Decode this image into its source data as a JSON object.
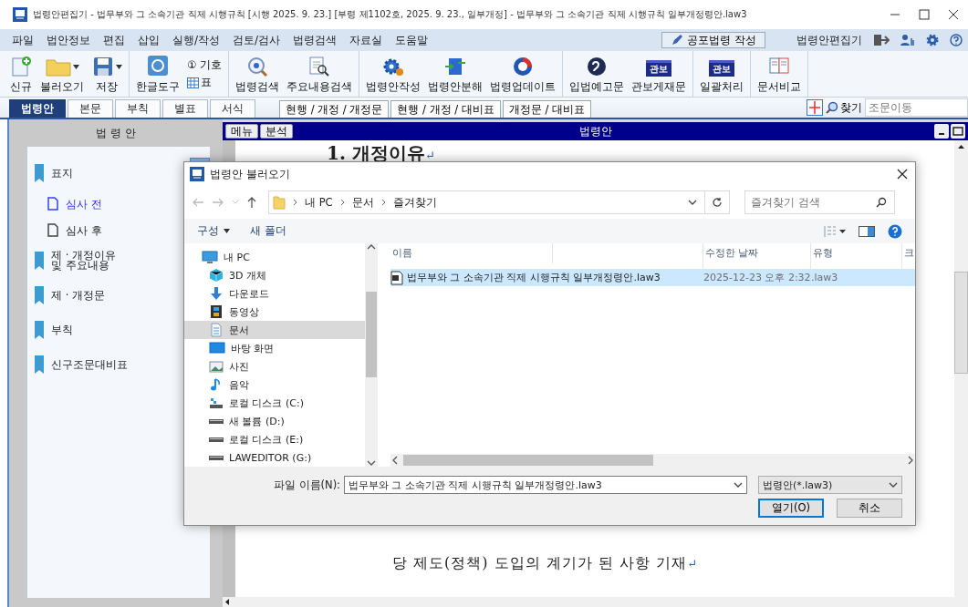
{
  "window": {
    "title": "법령안편집기 - 법무부와 그 소속기관 직제 시행규칙 [시행 2025. 9. 23.] [부령 제1102호, 2025. 9. 23., 일부개정] - 법무부와 그 소속기관 직제 시행규칙 일부개정령안.law3"
  },
  "menu": [
    "파일",
    "법안정보",
    "편집",
    "삽입",
    "실행/작성",
    "검토/검사",
    "법령검색",
    "자료실",
    "도움말"
  ],
  "menu_right": {
    "button": "공포법령 작성",
    "app_name": "법령안편집기"
  },
  "toolbar_groups": [
    {
      "items": [
        {
          "kind": "large",
          "label": "신규"
        },
        {
          "kind": "dropdown",
          "label": "불러오기"
        },
        {
          "kind": "dropdown",
          "label": "저장"
        }
      ]
    },
    {
      "items": [
        {
          "kind": "large",
          "label": "한글도구"
        },
        {
          "kind": "stack",
          "lines": [
            "① 기호",
            "표"
          ]
        }
      ]
    },
    {
      "items": [
        {
          "kind": "large",
          "label": "법령검색"
        },
        {
          "kind": "large",
          "label": "주요내용검색"
        }
      ]
    },
    {
      "items": [
        {
          "kind": "large",
          "label": "법령안작성"
        },
        {
          "kind": "large",
          "label": "법령안분해"
        },
        {
          "kind": "large",
          "label": "법령업데이트"
        }
      ]
    },
    {
      "items": [
        {
          "kind": "large",
          "label": "입법예고문"
        },
        {
          "kind": "badge",
          "badge": "관보",
          "label": "관보게재문"
        }
      ]
    },
    {
      "items": [
        {
          "kind": "badge",
          "badge": "관보",
          "label": "일괄처리"
        }
      ]
    },
    {
      "items": [
        {
          "kind": "large",
          "label": "문서비교"
        }
      ]
    }
  ],
  "tabs": [
    {
      "label": "법령안",
      "selected": true
    },
    {
      "label": "본문",
      "selected": false
    },
    {
      "label": "부칙",
      "selected": false
    },
    {
      "label": "별표",
      "selected": false
    },
    {
      "label": "서식",
      "selected": false
    }
  ],
  "view_tabs": [
    {
      "label": "현행 / 개정 / 개정문",
      "selected": false
    },
    {
      "label": "현행 / 개정 / 대비표",
      "selected": false
    },
    {
      "label": "개정문 / 대비표",
      "selected": false
    }
  ],
  "find": {
    "label": "찾기",
    "placeholder": "조문이동"
  },
  "outline": {
    "title": "법 령 안",
    "items": [
      {
        "kind": "checkable",
        "label": "표지",
        "selected": false,
        "children": [
          {
            "kind": "page",
            "label": "심사 전",
            "selected": true
          },
          {
            "kind": "page",
            "label": "심사 후",
            "selected": false
          }
        ]
      },
      {
        "kind": "expandable",
        "label": "제 · 개정이유\n및 주요내용",
        "selected": false
      },
      {
        "kind": "expandable",
        "label": "제 · 개정문",
        "selected": false
      },
      {
        "kind": "expandable",
        "label": "부칙",
        "selected": false
      },
      {
        "kind": "plain",
        "label": "신구조문대비표",
        "selected": false
      }
    ]
  },
  "document": {
    "buttons": [
      "메뉴",
      "분석"
    ],
    "title": "법령안",
    "heading": "1. 개정이유",
    "heading_mark": "↵",
    "paragraph": "당 제도(정책) 도입의 계기가 된 사항 기재",
    "paragraph_mark": "↵"
  },
  "dialog": {
    "title": "법령안 불러오기",
    "path": [
      "내 PC",
      "문서",
      "즐겨찾기"
    ],
    "search_placeholder": "즐겨찾기 검색",
    "commands": [
      {
        "label": "구성",
        "dropdown": true
      },
      {
        "label": "새 폴더",
        "dropdown": false
      }
    ],
    "nav": [
      {
        "label": "내 PC",
        "selected": false,
        "children": [
          {
            "label": "3D 개체",
            "selected": false
          },
          {
            "label": "다운로드",
            "selected": false
          },
          {
            "label": "동영상",
            "selected": false
          },
          {
            "label": "문서",
            "selected": true
          },
          {
            "label": "바탕 화면",
            "selected": false
          },
          {
            "label": "사진",
            "selected": false
          },
          {
            "label": "음악",
            "selected": false
          },
          {
            "label": "로컬 디스크 (C:)",
            "selected": false
          },
          {
            "label": "새 볼륨 (D:)",
            "selected": false
          },
          {
            "label": "로컬 디스크 (E:)",
            "selected": false
          },
          {
            "label": "LAWEDITOR (G:)",
            "selected": false
          }
        ]
      }
    ],
    "columns": [
      "이름",
      "수정한 날짜",
      "유형",
      "크"
    ],
    "files": [
      {
        "name": "법무부와 그 소속기관 직제 시행규칙 일부개정령안.law3",
        "date": "2025-12-23 오후 2:32",
        "type": ".law3",
        "selected": true
      }
    ],
    "file_name_label": "파일 이름(N):",
    "file_name": "법무부와 그 소속기관 직제 시행규칙 일부개정령안.law3",
    "file_type": "법령안(*.law3)",
    "buttons": [
      {
        "label": "열기(O)",
        "default": true
      },
      {
        "label": "취소",
        "default": false
      }
    ]
  }
}
